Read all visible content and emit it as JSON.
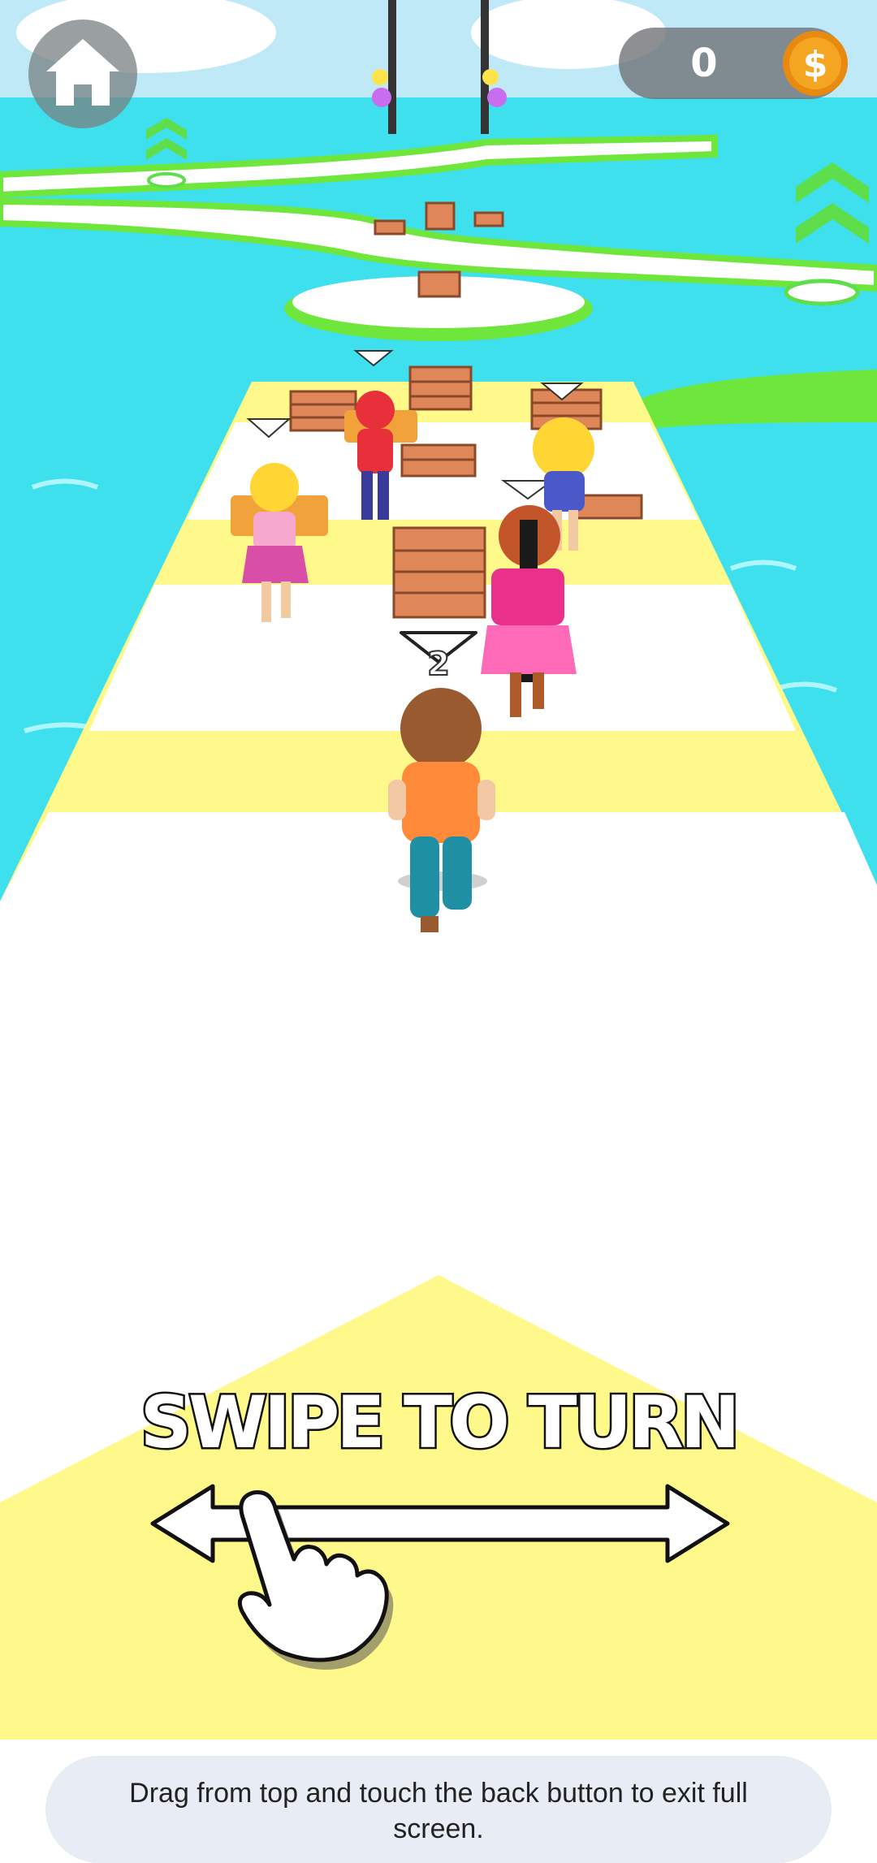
{
  "hud": {
    "coin_count": "0",
    "coin_symbol": "$",
    "home_icon": "home-icon"
  },
  "player": {
    "stack_count": "2"
  },
  "tutorial": {
    "instruction": "SWIPE TO TURN",
    "gesture_icon": "hand-pointer-icon"
  },
  "system": {
    "fullscreen_hint": "Drag from top and touch the back button to exit full screen."
  },
  "colors": {
    "water": "#3fe0ee",
    "track_white": "#ffffff",
    "track_yellow": "#fff88a",
    "grass_green": "#6fe63b",
    "coin_gold": "#f4a623"
  }
}
